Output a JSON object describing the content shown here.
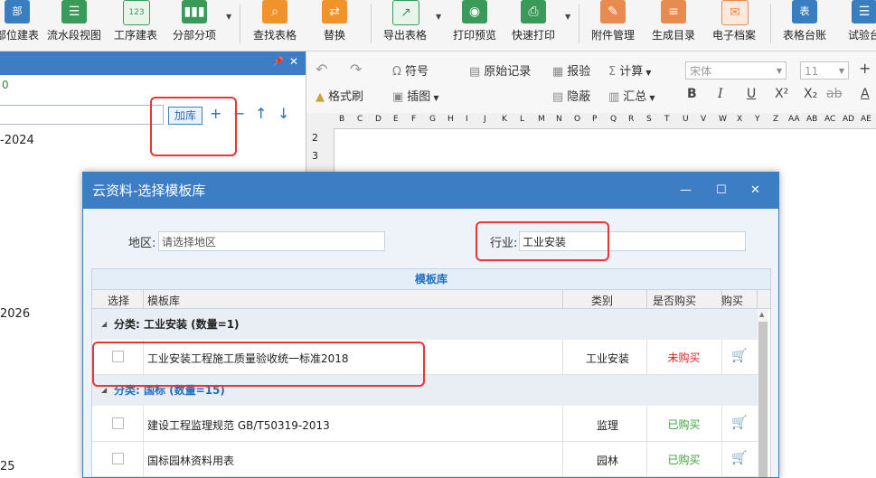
{
  "toolbar": {
    "items": [
      {
        "label": "部位建表",
        "icon_text": "部",
        "icon": "table-icon",
        "color": "#3a7ec2"
      },
      {
        "label": "流水段视图",
        "icon": "flow-tree-icon",
        "color": "#3a9a5a"
      },
      {
        "label": "工序建表",
        "icon_text": "123",
        "icon": "process-table-icon",
        "color": "#3a9a5a"
      },
      {
        "label": "分部分项",
        "icon": "bar-chart-icon",
        "color": "#3a9a5a"
      },
      {
        "label": "查找表格",
        "icon": "search-icon",
        "color": "#f0932b"
      },
      {
        "label": "替换",
        "icon": "replace-icon",
        "color": "#f0932b"
      },
      {
        "label": "导出表格",
        "icon": "export-icon",
        "color": "#3a9a5a"
      },
      {
        "label": "打印预览",
        "icon": "eye-icon",
        "color": "#3a9a5a"
      },
      {
        "label": "快速打印",
        "icon": "printer-icon",
        "color": "#3a9a5a"
      },
      {
        "label": "附件管理",
        "icon": "paperclip-icon",
        "color": "#e88b50"
      },
      {
        "label": "生成目录",
        "icon": "list-icon",
        "color": "#e88b50"
      },
      {
        "label": "电子档案",
        "icon": "archive-icon",
        "color": "#e88b50"
      },
      {
        "label": "表格台账",
        "icon_text": "表",
        "icon": "ledger-icon",
        "color": "#3a7ec2"
      },
      {
        "label": "试验台",
        "icon": "lab-icon",
        "color": "#3a7ec2"
      }
    ]
  },
  "left_panel": {
    "count_text": "0",
    "add_lib_label": "加库",
    "years": [
      "-2024",
      "2026",
      "25"
    ]
  },
  "ribbon": {
    "symbol": "符号",
    "original_record": "原始记录",
    "report_check": "报验",
    "calc": "计算",
    "format_brush": "格式刷",
    "insert_image": "插图",
    "hide": "隐蔽",
    "summary": "汇总",
    "font_name": "宋体",
    "font_size": "11"
  },
  "sheet": {
    "columns": [
      "B",
      "C",
      "D",
      "E",
      "F",
      "G",
      "H",
      "I",
      "J",
      "K",
      "L",
      "M",
      "N",
      "O",
      "P",
      "Q",
      "R",
      "S",
      "T",
      "U",
      "V",
      "W",
      "X",
      "Y",
      "Z",
      "AA",
      "AB",
      "AC",
      "AD",
      "AE"
    ],
    "rows": [
      "2",
      "3"
    ]
  },
  "dialog": {
    "title": "云资料-选择模板库",
    "region_label": "地区:",
    "region_placeholder": "请选择地区",
    "industry_label": "行业:",
    "industry_value": "工业安装",
    "grid_title": "模板库",
    "headers": {
      "select": "选择",
      "library": "模板库",
      "category": "类别",
      "purchased": "是否购买",
      "buy": "购买"
    },
    "groups": [
      {
        "title": "分类: 工业安装 (数量=1)",
        "color": "#222222",
        "rows": [
          {
            "name": "工业安装工程施工质量验收统一标准2018",
            "category": "工业安装",
            "status": "未购买",
            "status_color": "#e02020",
            "cart_color": "#1f6fc0"
          }
        ]
      },
      {
        "title": "分类: 国标 (数量=15)",
        "color": "#1f6fc0",
        "rows": [
          {
            "name": "建设工程监理规范 GB/T50319-2013",
            "category": "监理",
            "status": "已购买",
            "status_color": "#3aa23a",
            "cart_color": "#c8c8c8"
          },
          {
            "name": "国标园林资料用表",
            "category": "园林",
            "status": "已购买",
            "status_color": "#3aa23a",
            "cart_color": "#c8c8c8"
          }
        ]
      }
    ]
  }
}
